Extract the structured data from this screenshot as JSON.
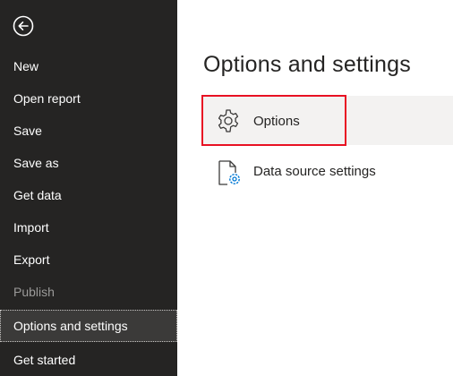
{
  "sidebar": {
    "back_icon": "back-arrow-circle-icon",
    "items": [
      {
        "label": "New"
      },
      {
        "label": "Open report"
      },
      {
        "label": "Save"
      },
      {
        "label": "Save as"
      },
      {
        "label": "Get data"
      },
      {
        "label": "Import"
      },
      {
        "label": "Export"
      },
      {
        "label": "Publish"
      },
      {
        "label": "Options and settings"
      },
      {
        "label": "Get started"
      }
    ],
    "selected_item": "Options and settings",
    "disabled_items": [
      "Publish"
    ]
  },
  "main": {
    "title": "Options and settings",
    "options": [
      {
        "label": "Options",
        "icon": "gear-icon"
      },
      {
        "label": "Data source settings",
        "icon": "document-gear-icon"
      }
    ]
  },
  "colors": {
    "sidebar_bg": "#252423",
    "selected_bg": "#3b3a39",
    "highlight_border": "#e81123",
    "accent_blue": "#0078d4"
  }
}
